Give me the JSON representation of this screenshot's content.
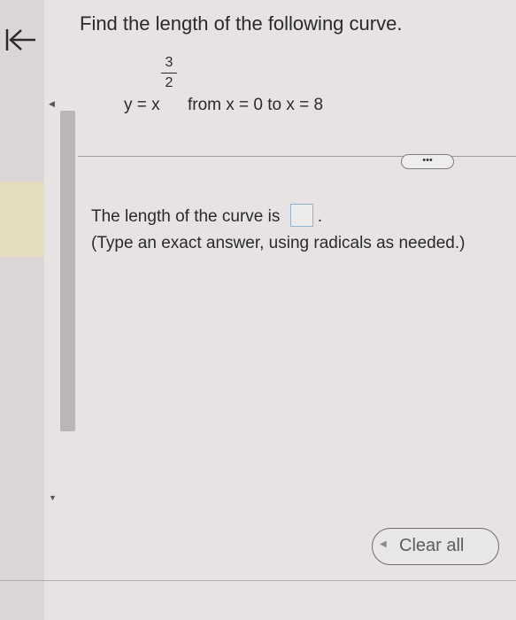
{
  "question": {
    "text": "Find the length of the following curve."
  },
  "equation": {
    "lhs": "y = x",
    "exp_numerator": "3",
    "exp_denominator": "2",
    "range_text": "from x = 0 to x = 8"
  },
  "more_button": {
    "label": "•••"
  },
  "answer": {
    "prompt": "The length of the curve is",
    "value": "",
    "period": ".",
    "hint": "(Type an exact answer, using radicals as needed.)"
  },
  "actions": {
    "clear_all_label": "Clear all"
  },
  "colors": {
    "background": "#e6e3e2",
    "answer_box_border": "#8fb2cf",
    "text": "#2a2a2e"
  },
  "icons": {
    "back": "back-arrow-icon",
    "scroll_up": "scroll-up-arrow-icon",
    "scroll_down": "scroll-down-arrow-icon",
    "clear": "clear-icon"
  }
}
